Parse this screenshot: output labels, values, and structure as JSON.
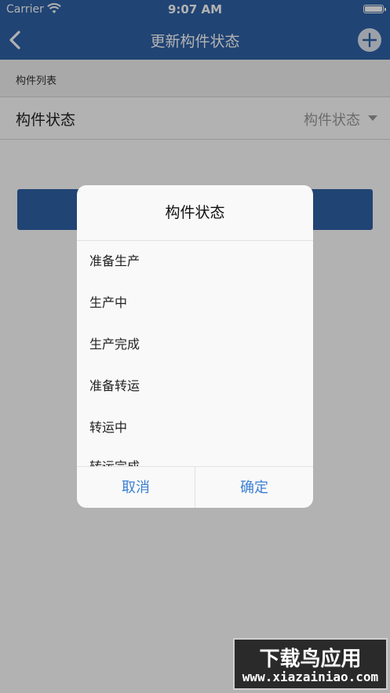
{
  "status_bar": {
    "carrier": "Carrier",
    "time": "9:07 AM"
  },
  "nav": {
    "title": "更新构件状态",
    "back_icon": "chevron-left-icon",
    "add_icon": "plus-circle-icon"
  },
  "form": {
    "section_header": "构件列表",
    "status_row": {
      "label": "构件状态",
      "value": "构件状态"
    }
  },
  "dialog": {
    "title": "构件状态",
    "options": [
      "准备生产",
      "生产中",
      "生产完成",
      "准备转运",
      "转运中",
      "转运完成"
    ],
    "cancel": "取消",
    "confirm": "确定"
  },
  "watermark": {
    "main": "下载鸟应用",
    "sub": "www.xiazainiao.com"
  },
  "colors": {
    "nav_bg": "#2e62a7",
    "button_text": "#3b7fd4"
  }
}
